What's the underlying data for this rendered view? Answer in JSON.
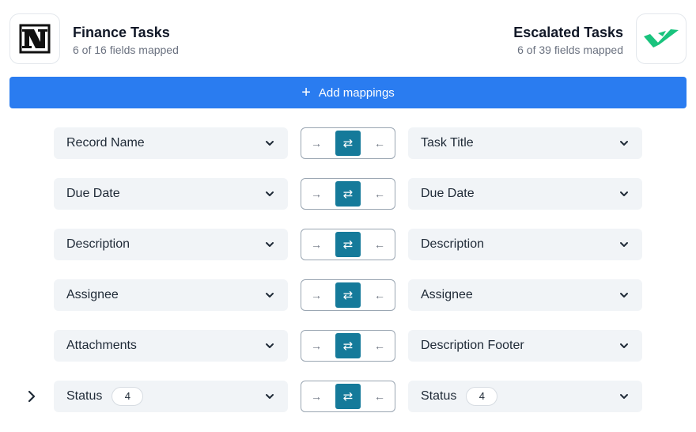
{
  "left_app": {
    "name": "Finance Tasks",
    "status": "6 of 16 fields mapped",
    "logo": "notion-logo"
  },
  "right_app": {
    "name": "Escalated Tasks",
    "status": "6 of 39 fields mapped",
    "logo": "checkmark-logo"
  },
  "add_button": {
    "label": "Add mappings",
    "icon": "plus-icon"
  },
  "colors": {
    "accent": "#2a7cf0",
    "sync_active": "#157a9a",
    "field_bg": "#f1f4f7",
    "brand_green": "#19c37d"
  },
  "direction_icons": {
    "to_right": "→",
    "both": "⇄",
    "to_left": "←"
  },
  "mappings": [
    {
      "left": "Record Name",
      "right": "Task Title",
      "direction": "both"
    },
    {
      "left": "Due Date",
      "right": "Due Date",
      "direction": "both"
    },
    {
      "left": "Description",
      "right": "Description",
      "direction": "both"
    },
    {
      "left": "Assignee",
      "right": "Assignee",
      "direction": "both"
    },
    {
      "left": "Attachments",
      "right": "Description Footer",
      "direction": "both"
    },
    {
      "left": "Status",
      "left_count": "4",
      "right": "Status",
      "right_count": "4",
      "direction": "both",
      "expandable": true
    }
  ]
}
